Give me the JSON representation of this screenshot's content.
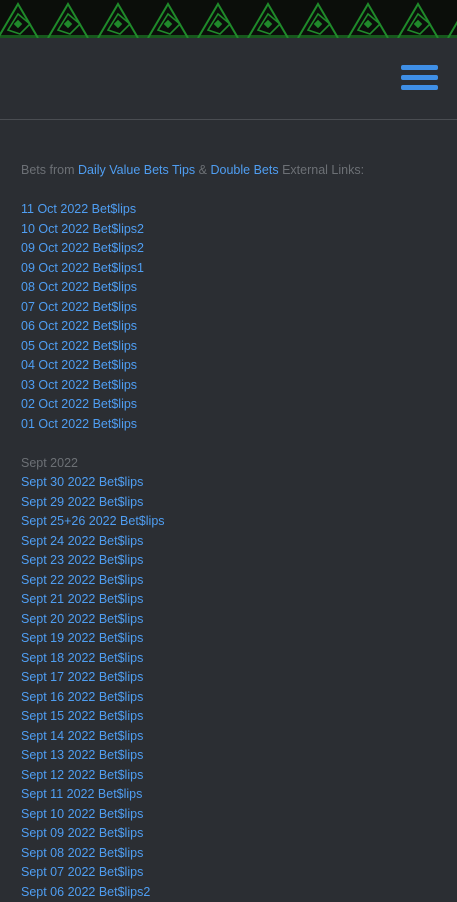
{
  "intro": {
    "prefix": "Bets from",
    "link1": "Daily Value Bets Tips",
    "amp": "&",
    "link2": "Double Bets",
    "suffix": "External Links:"
  },
  "oct_links": [
    "11 Oct 2022 Bet$lips",
    "10 Oct 2022 Bet$lips2",
    "09 Oct 2022 Bet$lips2",
    "09 Oct 2022 Bet$lips1",
    "08 Oct 2022 Bet$lips",
    "07 Oct 2022 Bet$lips",
    "06 Oct 2022 Bet$lips",
    "05 Oct 2022 Bet$lips",
    "04 Oct 2022 Bet$lips",
    "03 Oct 2022 Bet$lips",
    "02 Oct 2022 Bet$lips",
    "01 Oct 2022 Bet$lips"
  ],
  "sept_heading": "Sept 2022",
  "sept_links": [
    "Sept 30 2022 Bet$lips",
    "Sept 29 2022 Bet$lips",
    "Sept 25+26 2022 Bet$lips",
    "Sept 24 2022 Bet$lips",
    "Sept 23 2022 Bet$lips",
    "Sept 22 2022 Bet$lips",
    "Sept 21 2022 Bet$lips",
    "Sept 20 2022 Bet$lips",
    "Sept 19 2022 Bet$lips",
    "Sept 18 2022 Bet$lips",
    "Sept 17 2022 Bet$lips",
    "Sept 16 2022 Bet$lips",
    "Sept 15 2022 Bet$lips",
    "Sept 14 2022 Bet$lips",
    "Sept 13 2022 Bet$lips",
    "Sept 12 2022 Bet$lips",
    "Sept 11 2022 Bet$lips",
    "Sept 10 2022 Bet$lips",
    "Sept 09 2022 Bet$lips",
    "Sept 08 2022 Bet$lips",
    "Sept 07 2022 Bet$lips",
    "Sept 06 2022 Bet$lips2"
  ],
  "colors": {
    "background": "#2b2e33",
    "link": "#4f9ef2",
    "muted_text": "#6c7075",
    "menu_accent": "#3f8fe6",
    "banner_pattern": "#1f8a2a"
  },
  "icons": {
    "menu": "hamburger-menu-icon",
    "banner": "green-diamond-pattern-banner"
  }
}
